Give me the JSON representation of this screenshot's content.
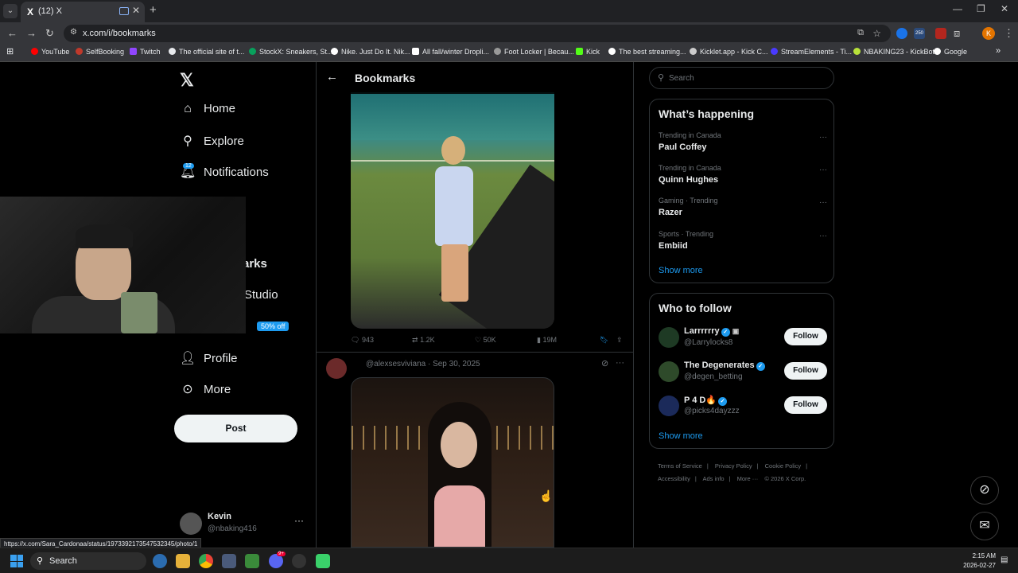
{
  "browser": {
    "tab_title": "(12) X",
    "tab_favicon": "X",
    "url": "x.com/i/bookmarks",
    "bookmarks": [
      "YouTube",
      "SelfBooking",
      "Twitch",
      "The official site of t...",
      "StockX: Sneakers, St...",
      "Nike. Just Do It. Nik...",
      "All fall/winter Dropli...",
      "Foot Locker | Becau...",
      "Kick",
      "The best streaming...",
      "Kicklet.app - Kick C...",
      "StreamElements - Ti...",
      "NBAKING23 - KickBot",
      "Google"
    ],
    "ext_badge": "250",
    "profile_initial": "K",
    "status_url": "https://x.com/Sara_Cardonaa/status/1973392173547532345/photo/1"
  },
  "sidebar": {
    "logo": "𝕏",
    "home": "Home",
    "explore": "Explore",
    "notifications": "Notifications",
    "notif_count": "12",
    "bookmarks_partial": "arks",
    "studio_partial": "Studio",
    "sale_badge": "50% off",
    "profile": "Profile",
    "more": "More",
    "post_button": "Post",
    "account_name": "Kevin",
    "account_handle": "@nbaking416"
  },
  "main": {
    "title": "Bookmarks",
    "tweet1": {
      "replies": "943",
      "reposts": "1.2K",
      "likes": "50K",
      "views": "19M"
    },
    "tweet2": {
      "meta": "@alexsesviviana · Sep 30, 2025"
    }
  },
  "right": {
    "search_placeholder": "Search",
    "happening_title": "What’s happening",
    "trends": [
      {
        "meta": "Trending in Canada",
        "name": "Paul Coffey"
      },
      {
        "meta": "Trending in Canada",
        "name": "Quinn Hughes"
      },
      {
        "meta": "Gaming · Trending",
        "name": "Razer"
      },
      {
        "meta": "Sports · Trending",
        "name": "Embiid"
      }
    ],
    "show_more": "Show more",
    "who_to_follow_title": "Who to follow",
    "follow": [
      {
        "name": "Larrrrrry",
        "handle": "@Larrylocks8",
        "button": "Follow"
      },
      {
        "name": "The Degenerates",
        "handle": "@degen_betting",
        "button": "Follow"
      },
      {
        "name": "P 4 D🔥",
        "handle": "@picks4dayzzz",
        "button": "Follow"
      }
    ],
    "show_more_2": "Show more",
    "footer": [
      "Terms of Service",
      "|",
      "Privacy Policy",
      "|",
      "Cookie Policy",
      "|",
      "Accessibility",
      "|",
      "Ads info",
      "|",
      "More ···",
      "© 2026 X Corp."
    ]
  },
  "taskbar": {
    "search_label": "Search",
    "time": "2:15 AM",
    "date": "2026-02-27",
    "discord_badge": "9+"
  },
  "colors": {
    "accent": "#1d9bf0",
    "background": "#000000",
    "text": "#e7e9ea",
    "muted": "#71767b"
  }
}
